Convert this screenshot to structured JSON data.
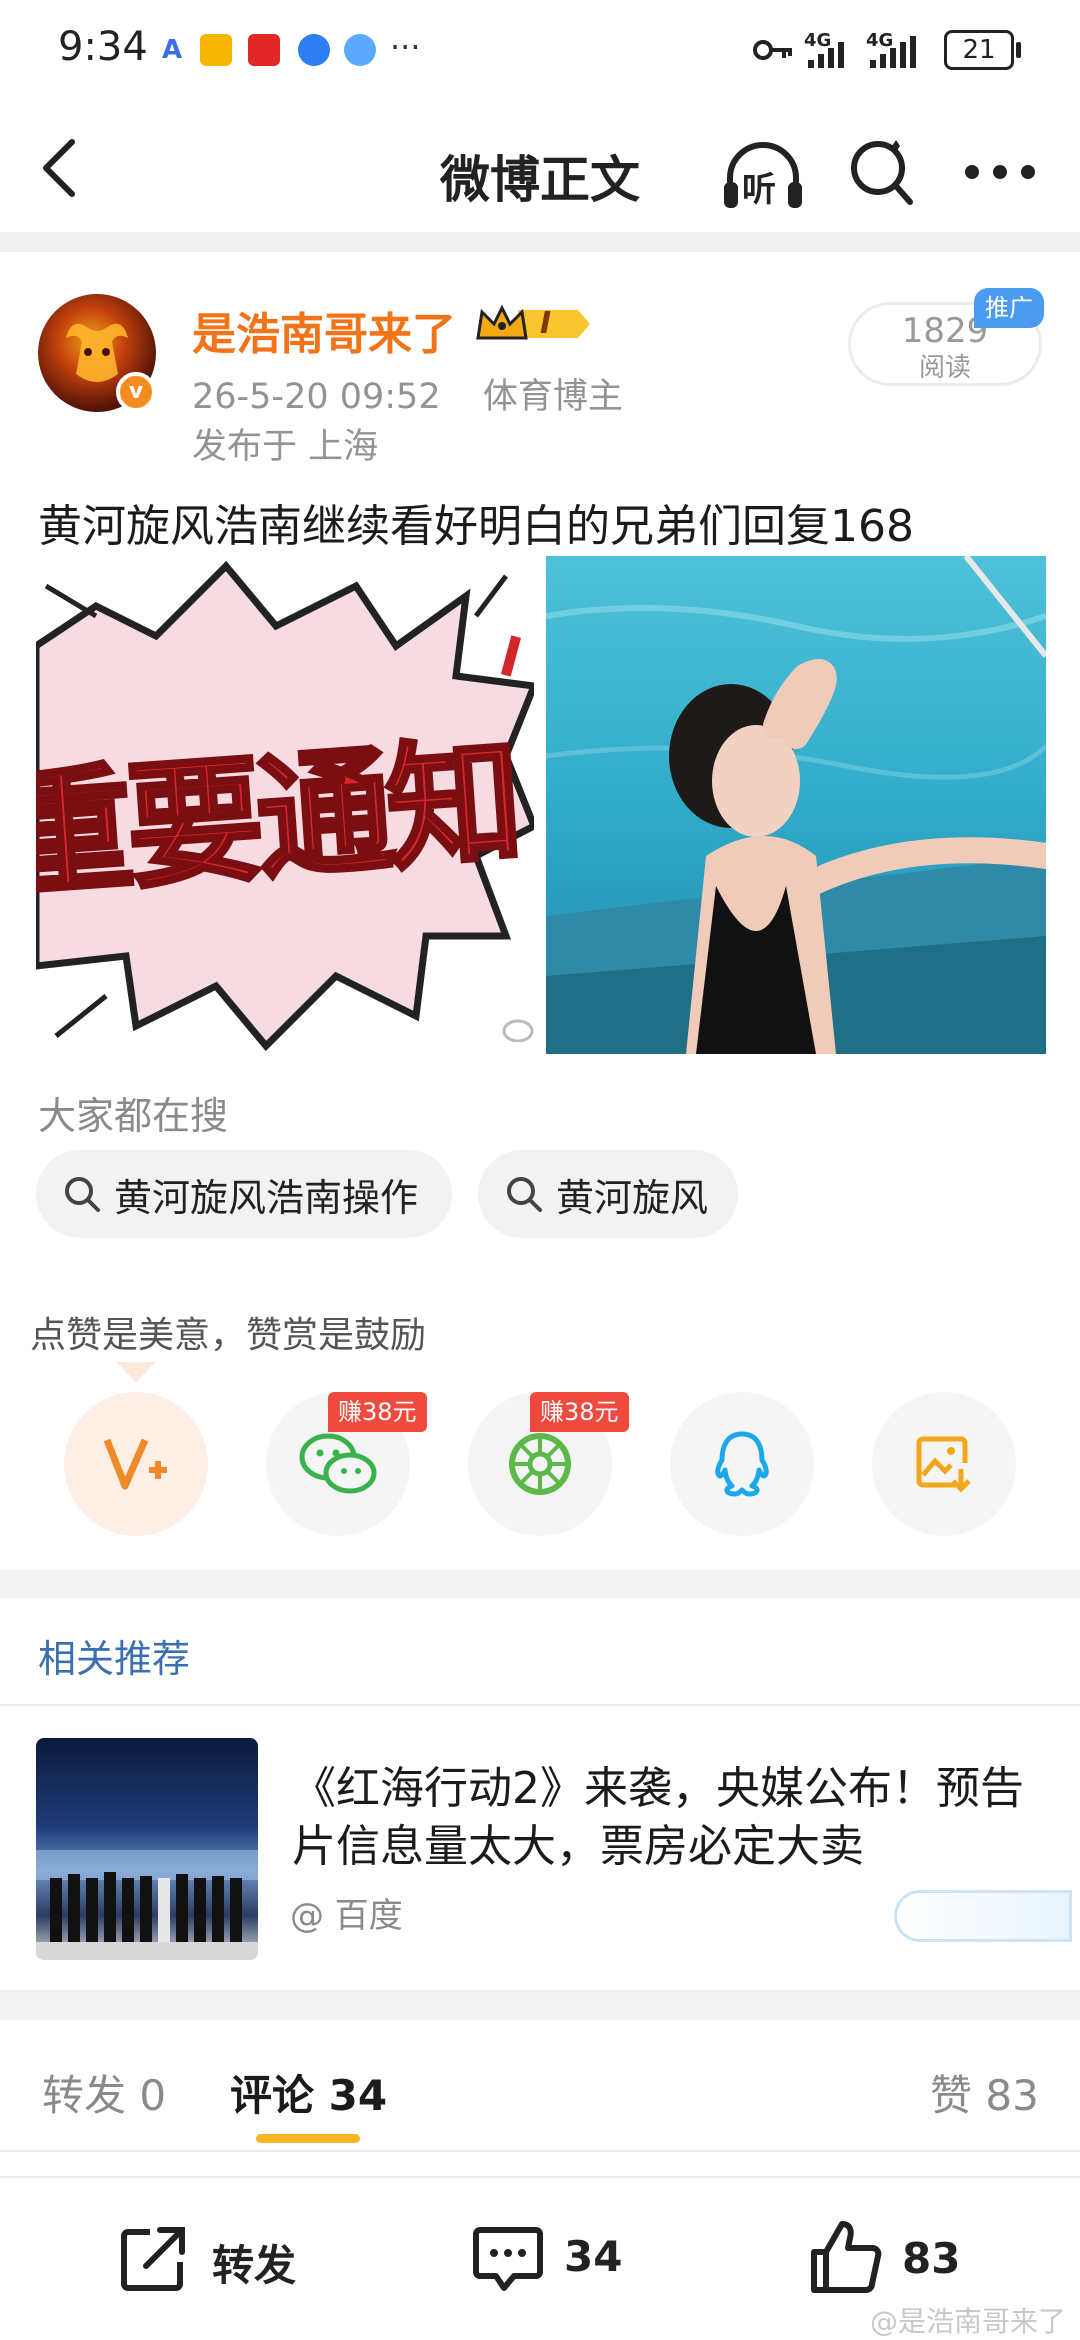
{
  "status_bar": {
    "time": "9:34",
    "more": "···",
    "network1": "4G",
    "network2": "4G",
    "battery": "21"
  },
  "nav": {
    "title": "微博正文",
    "listen_label": "听"
  },
  "post": {
    "author": "是浩南哥来了",
    "vip_level": "I",
    "verified_badge": "v",
    "date": "26-5-20 09:52",
    "role": "体育博主",
    "location": "发布于 上海",
    "read_count": "1829",
    "read_label": "阅读",
    "promo_badge": "推广",
    "text": "黄河旋风浩南继续看好明白的兄弟们回复168",
    "image1_text": "重要通知"
  },
  "search": {
    "label": "大家都在搜",
    "chips": [
      "黄河旋风浩南操作",
      "黄河旋风"
    ]
  },
  "share": {
    "tip": "点赞是美意，赞赏是鼓励",
    "earn_badge": "赚38元",
    "items": [
      "reward-icon",
      "wechat-icon",
      "moments-icon",
      "qq-icon",
      "save-image-icon"
    ]
  },
  "related": {
    "title": "相关推荐",
    "article_title": "《红海行动2》来袭，央媒公布！预告片信息量太大，票房必定大卖",
    "source": "@ 百度"
  },
  "tabs": {
    "repost": "转发 0",
    "comments": "评论 34",
    "likes": "赞 83"
  },
  "bottom": {
    "repost_label": "转发",
    "comment_count": "34",
    "like_count": "83"
  },
  "watermark": "@是浩南哥来了",
  "colors": {
    "accent_orange": "#f27318",
    "link_blue": "#3a6fb0",
    "tab_underline": "#f8b521",
    "earn_red": "#f04a3e"
  }
}
